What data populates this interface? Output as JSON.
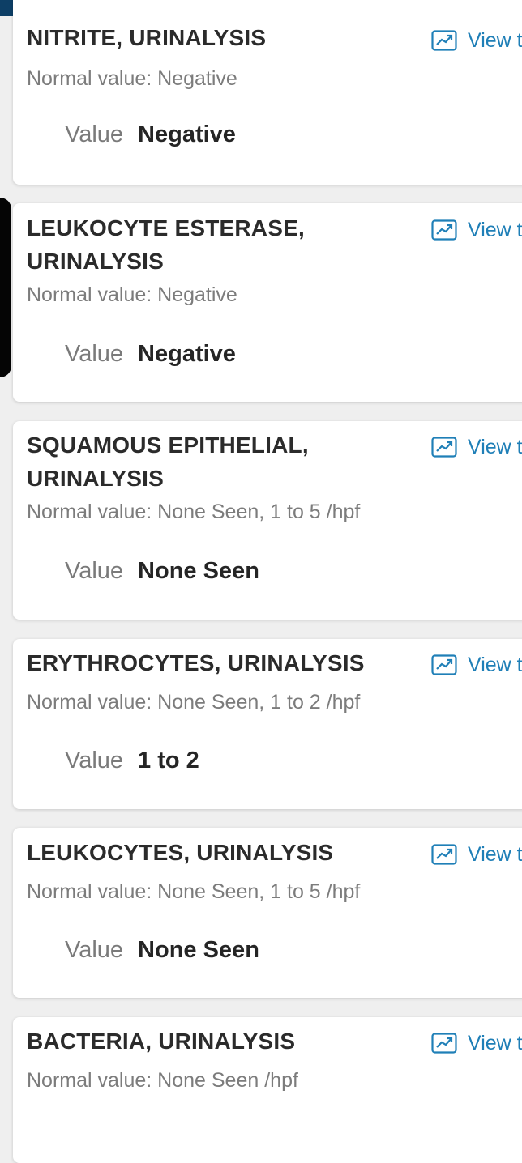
{
  "value_label": "Value",
  "trend_link_label": "View t",
  "results": [
    {
      "name": "NITRITE, URINALYSIS",
      "normal": "Normal value: Negative",
      "value": "Negative"
    },
    {
      "name": "LEUKOCYTE ESTERASE, URINALYSIS",
      "normal": "Normal value: Negative",
      "value": "Negative"
    },
    {
      "name": "SQUAMOUS EPITHELIAL, URINALYSIS",
      "normal": "Normal value: None Seen, 1 to 5 /hpf",
      "value": "None Seen"
    },
    {
      "name": "ERYTHROCYTES, URINALYSIS",
      "normal": "Normal value: None Seen, 1 to 2 /hpf",
      "value": "1 to 2"
    },
    {
      "name": "LEUKOCYTES, URINALYSIS",
      "normal": "Normal value: None Seen, 1 to 5 /hpf",
      "value": "None Seen"
    },
    {
      "name": "BACTERIA, URINALYSIS",
      "normal": "Normal value: None Seen /hpf",
      "value": ""
    }
  ],
  "colors": {
    "header": "#0d3f66",
    "logo_ring": "#7cc243",
    "link": "#1f7fb7"
  },
  "icons": {
    "trend": "trend-chart-icon"
  }
}
